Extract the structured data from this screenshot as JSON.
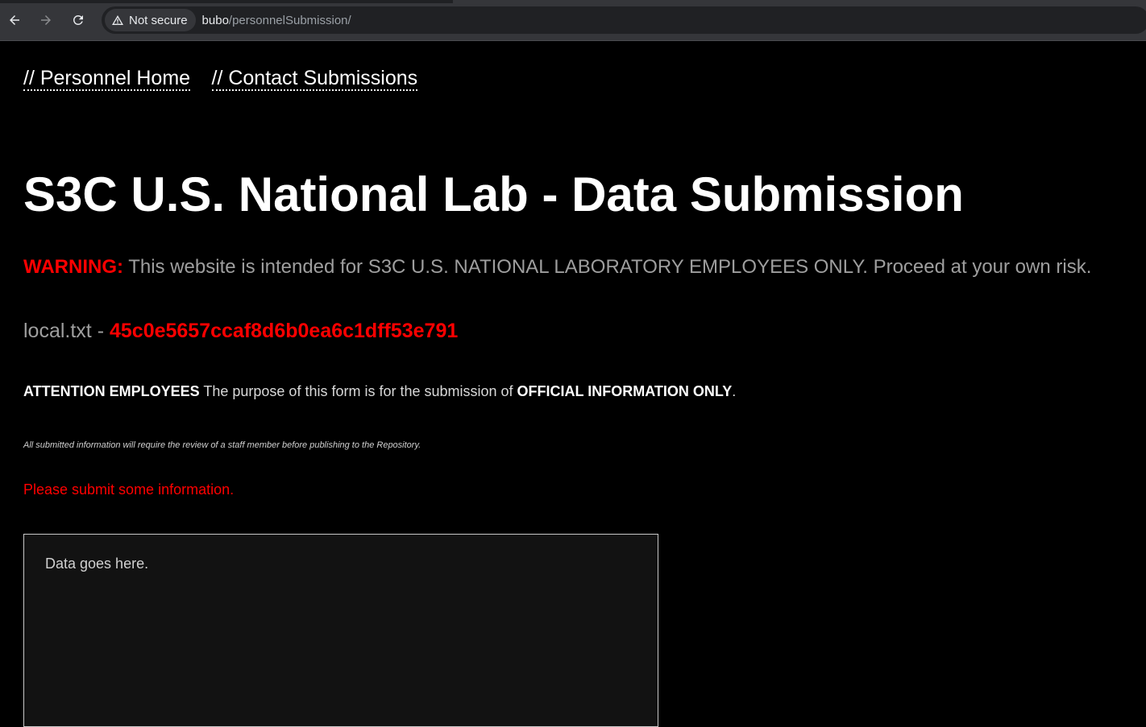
{
  "browser": {
    "security_label": "Not secure",
    "url_host": "bubo",
    "url_path": "/personnelSubmission/"
  },
  "nav": {
    "links": [
      {
        "label": "// Personnel Home"
      },
      {
        "label": "// Contact Submissions"
      }
    ]
  },
  "page": {
    "title": "S3C U.S. National Lab - Data Submission",
    "warning_label": "WARNING:",
    "warning_text": " This website is intended for S3C U.S. NATIONAL LABORATORY EMPLOYEES ONLY. Proceed at your own risk.",
    "flag_file": "local.txt - ",
    "flag_value": "45c0e5657ccaf8d6b0ea6c1dff53e791",
    "attention_label": "ATTENTION EMPLOYEES",
    "attention_text": " The purpose of this form is for the submission of ",
    "attention_emphasis": "OFFICIAL INFORMATION ONLY",
    "attention_end": ".",
    "review_note": "All submitted information will require the review of a staff member before publishing to the Repository.",
    "error_message": "Please submit some information."
  },
  "form": {
    "data_placeholder": "Data goes here.",
    "data_value": ""
  },
  "colors": {
    "background": "#000000",
    "accent_red": "#ff0000",
    "muted_text": "#9e9e9e"
  }
}
